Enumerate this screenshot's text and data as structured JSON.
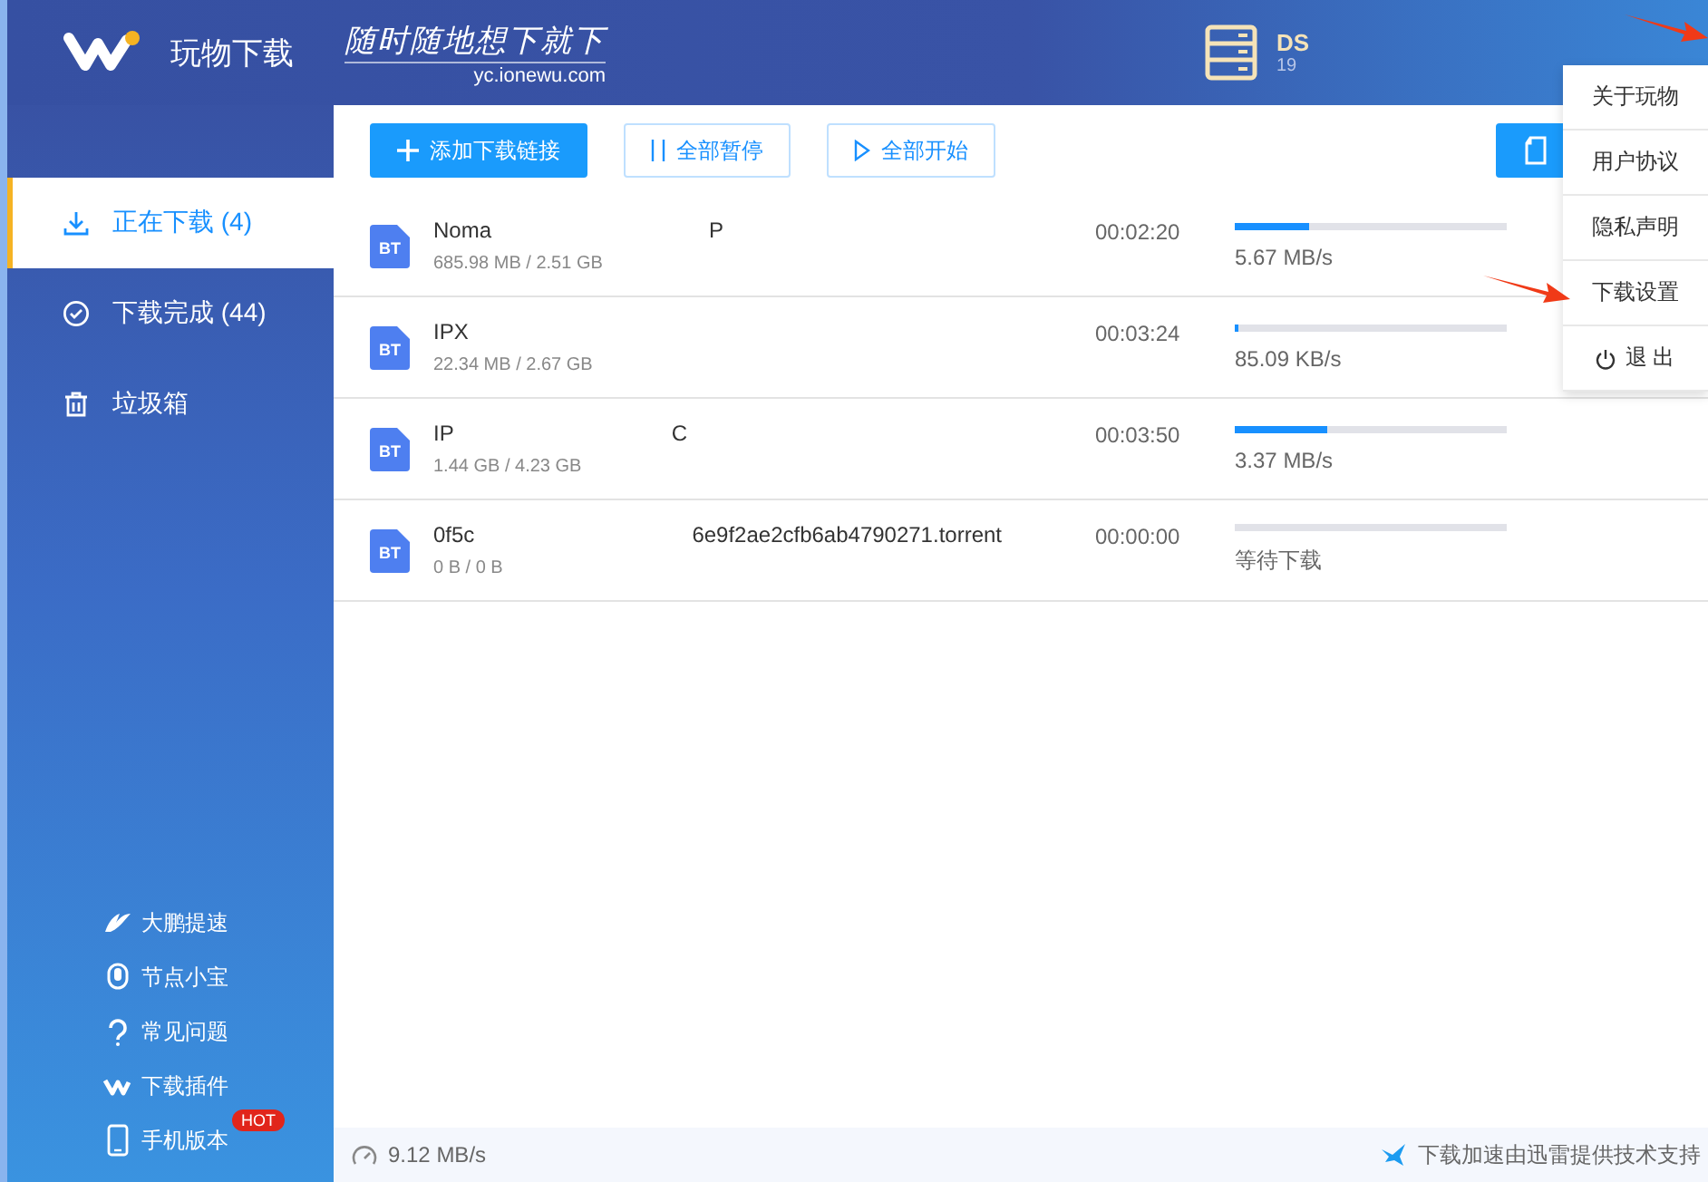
{
  "app": {
    "name": "玩物下载",
    "slogan": "随时随地想下就下",
    "url": "yc.ionewu.com"
  },
  "device": {
    "name": "DS",
    "address": "19"
  },
  "sidebar": {
    "items": [
      {
        "label": "正在下载 (4)",
        "selected": true,
        "kind": "download"
      },
      {
        "label": "下载完成 (44)",
        "selected": false,
        "kind": "done"
      },
      {
        "label": "垃圾箱",
        "selected": false,
        "kind": "trash"
      }
    ],
    "links": [
      {
        "label": "大鹏提速",
        "kind": "speed"
      },
      {
        "label": "节点小宝",
        "kind": "node"
      },
      {
        "label": "常见问题",
        "kind": "help"
      },
      {
        "label": "下载插件",
        "kind": "plugin"
      },
      {
        "label": "手机版本",
        "kind": "phone",
        "badge": "HOT"
      }
    ]
  },
  "toolbar": {
    "buttons": [
      {
        "label": "添加下载链接",
        "kind": "add"
      },
      {
        "label": "全部暂停",
        "kind": "pause"
      },
      {
        "label": "全部开始",
        "kind": "start"
      }
    ]
  },
  "downloads": [
    {
      "name": "Noma",
      "name_end": "P",
      "file_type": "BT",
      "size": "685.98 MB / 2.51 GB",
      "time": "00:02:20",
      "level": 0.27,
      "status": "5.67 MB/s"
    },
    {
      "name": "IPX",
      "file_type": "BT",
      "size": "22.34 MB / 2.67 GB",
      "time": "00:03:24",
      "level": 0.01,
      "status": "85.09 KB/s"
    },
    {
      "name": "IP",
      "name_end": "C",
      "file_type": "BT",
      "size": "1.44 GB / 4.23 GB",
      "time": "00:03:50",
      "level": 0.34,
      "status": "3.37 MB/s"
    },
    {
      "name": "0f5c",
      "name_end": "6e9f2ae2cfb6ab4790271.torrent",
      "file_type": "BT",
      "size": "0 B / 0 B",
      "time": "00:00:00",
      "level": 0,
      "status": "等待下载"
    }
  ],
  "menu": {
    "items": [
      {
        "label": "关于玩物",
        "kind": "text"
      },
      {
        "label": "用户协议",
        "kind": "text"
      },
      {
        "label": "隐私声明",
        "kind": "text"
      },
      {
        "label": "下载设置",
        "kind": "text"
      },
      {
        "label": "退 出",
        "kind": "power"
      }
    ]
  },
  "status_bar": {
    "speed": "9.12 MB/s",
    "credit": "下载加速由迅雷提供技术支持"
  }
}
